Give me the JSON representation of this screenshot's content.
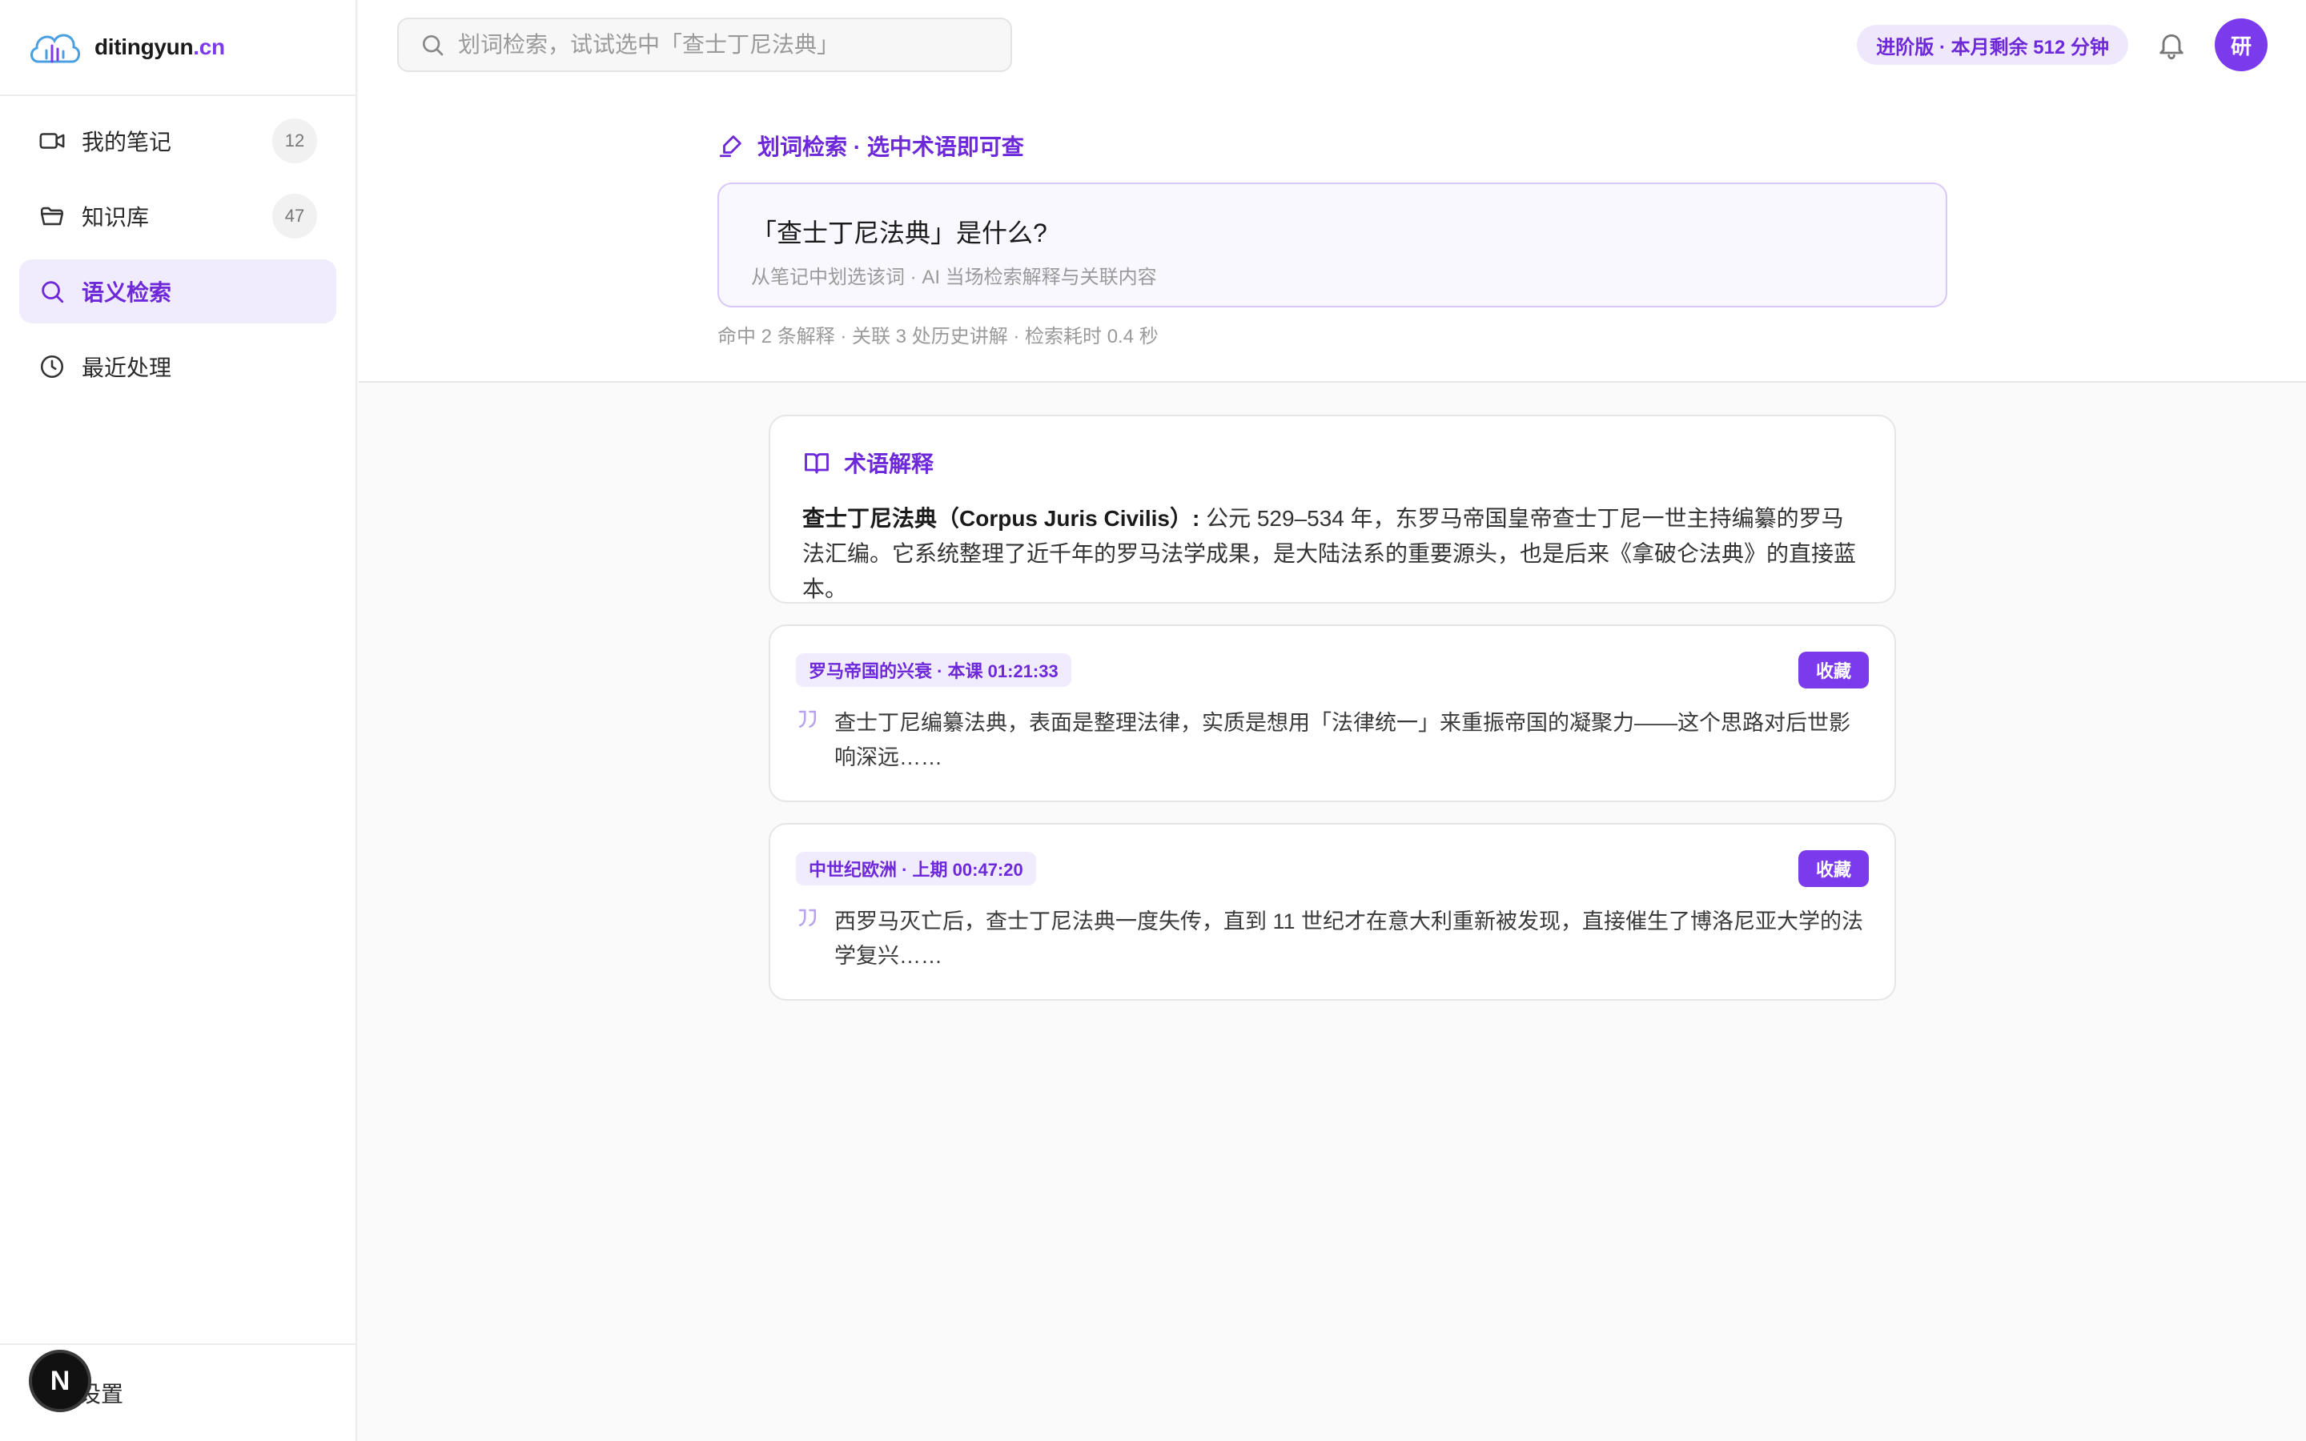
{
  "brand": {
    "name_main": "ditingyun",
    "name_tld": ".cn"
  },
  "sidebar": {
    "items": [
      {
        "label": "我的笔记",
        "count": "12",
        "icon": "video-icon"
      },
      {
        "label": "知识库",
        "count": "47",
        "icon": "folder-icon"
      },
      {
        "label": "语义检索",
        "icon": "search-icon",
        "active": true
      },
      {
        "label": "最近处理",
        "icon": "clock-icon"
      }
    ],
    "settings_label": "设置",
    "floating_badge": "N"
  },
  "topbar": {
    "search_placeholder": "划词检索，试试选中「查士丁尼法典」",
    "plan_text": "进阶版 · 本月剩余 512 分钟",
    "avatar_text": "研"
  },
  "query": {
    "section_title": "划词检索 · 选中术语即可查",
    "question": "「查士丁尼法典」是什么?",
    "hint": "从笔记中划选该词 · AI 当场检索解释与关联内容",
    "meta": "命中 2 条解释 · 关联 3 处历史讲解 · 检索耗时 0.4 秒"
  },
  "term_card": {
    "heading": "术语解释",
    "term": "查士丁尼法典（Corpus Juris Civilis）:",
    "definition": " 公元 529–534 年，东罗马帝国皇帝查士丁尼一世主持编纂的罗马法汇编。它系统整理了近千年的罗马法学成果，是大陆法系的重要源头，也是后来《拿破仑法典》的直接蓝本。"
  },
  "quotes": [
    {
      "source": "罗马帝国的兴衰 · 本课 01:21:33",
      "save_label": "收藏",
      "text": "查士丁尼编纂法典，表面是整理法律，实质是想用「法律统一」来重振帝国的凝聚力——这个思路对后世影响深远……"
    },
    {
      "source": "中世纪欧洲 · 上期 00:47:20",
      "save_label": "收藏",
      "text": "西罗马灭亡后，查士丁尼法典一度失传，直到 11 世纪才在意大利重新被发现，直接催生了博洛尼亚大学的法学复兴……"
    }
  ],
  "colors": {
    "accent": "#7c3aed",
    "accent_soft": "#f1ecfd",
    "text": "#1f1f1f",
    "muted": "#9a9a9a"
  }
}
